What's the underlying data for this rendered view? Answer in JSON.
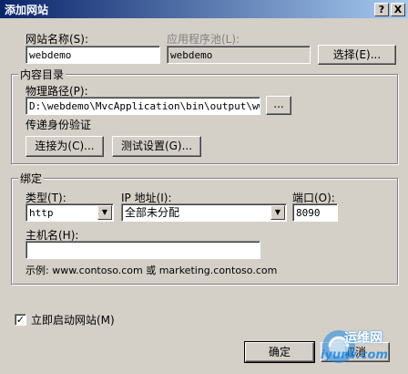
{
  "dialog": {
    "title": "添加网站",
    "help_glyph": "?",
    "close_glyph": "X"
  },
  "site_name": {
    "label": "网站名称(S):",
    "value": "webdemo"
  },
  "app_pool": {
    "label": "应用程序池(L):",
    "value": "webdemo",
    "select_button": "选择(E)..."
  },
  "content_dir": {
    "group_title": "内容目录",
    "physical_path_label": "物理路径(P):",
    "physical_path_value": "D:\\webdemo\\MvcApplication\\bin\\output\\wwwroot",
    "browse_button": "...",
    "passthrough_auth_label": "传递身份验证",
    "connect_as_button": "连接为(C)...",
    "test_settings_button": "测试设置(G)..."
  },
  "binding": {
    "group_title": "绑定",
    "type_label": "类型(T):",
    "type_value": "http",
    "ip_label": "IP 地址(I):",
    "ip_value": "全部未分配",
    "port_label": "端口(O):",
    "port_value": "8090",
    "host_label": "主机名(H):",
    "host_value": "",
    "example_text": "示例: www.contoso.com 或 marketing.contoso.com"
  },
  "start_immediately": {
    "label": "立即启动网站(M)",
    "checked": true,
    "check_glyph": "✓"
  },
  "ok_button": "确定",
  "cancel_button": "取消",
  "watermark": {
    "text": "运维网",
    "url": "iyunv.com"
  },
  "icons": {
    "dropdown": "▼"
  }
}
